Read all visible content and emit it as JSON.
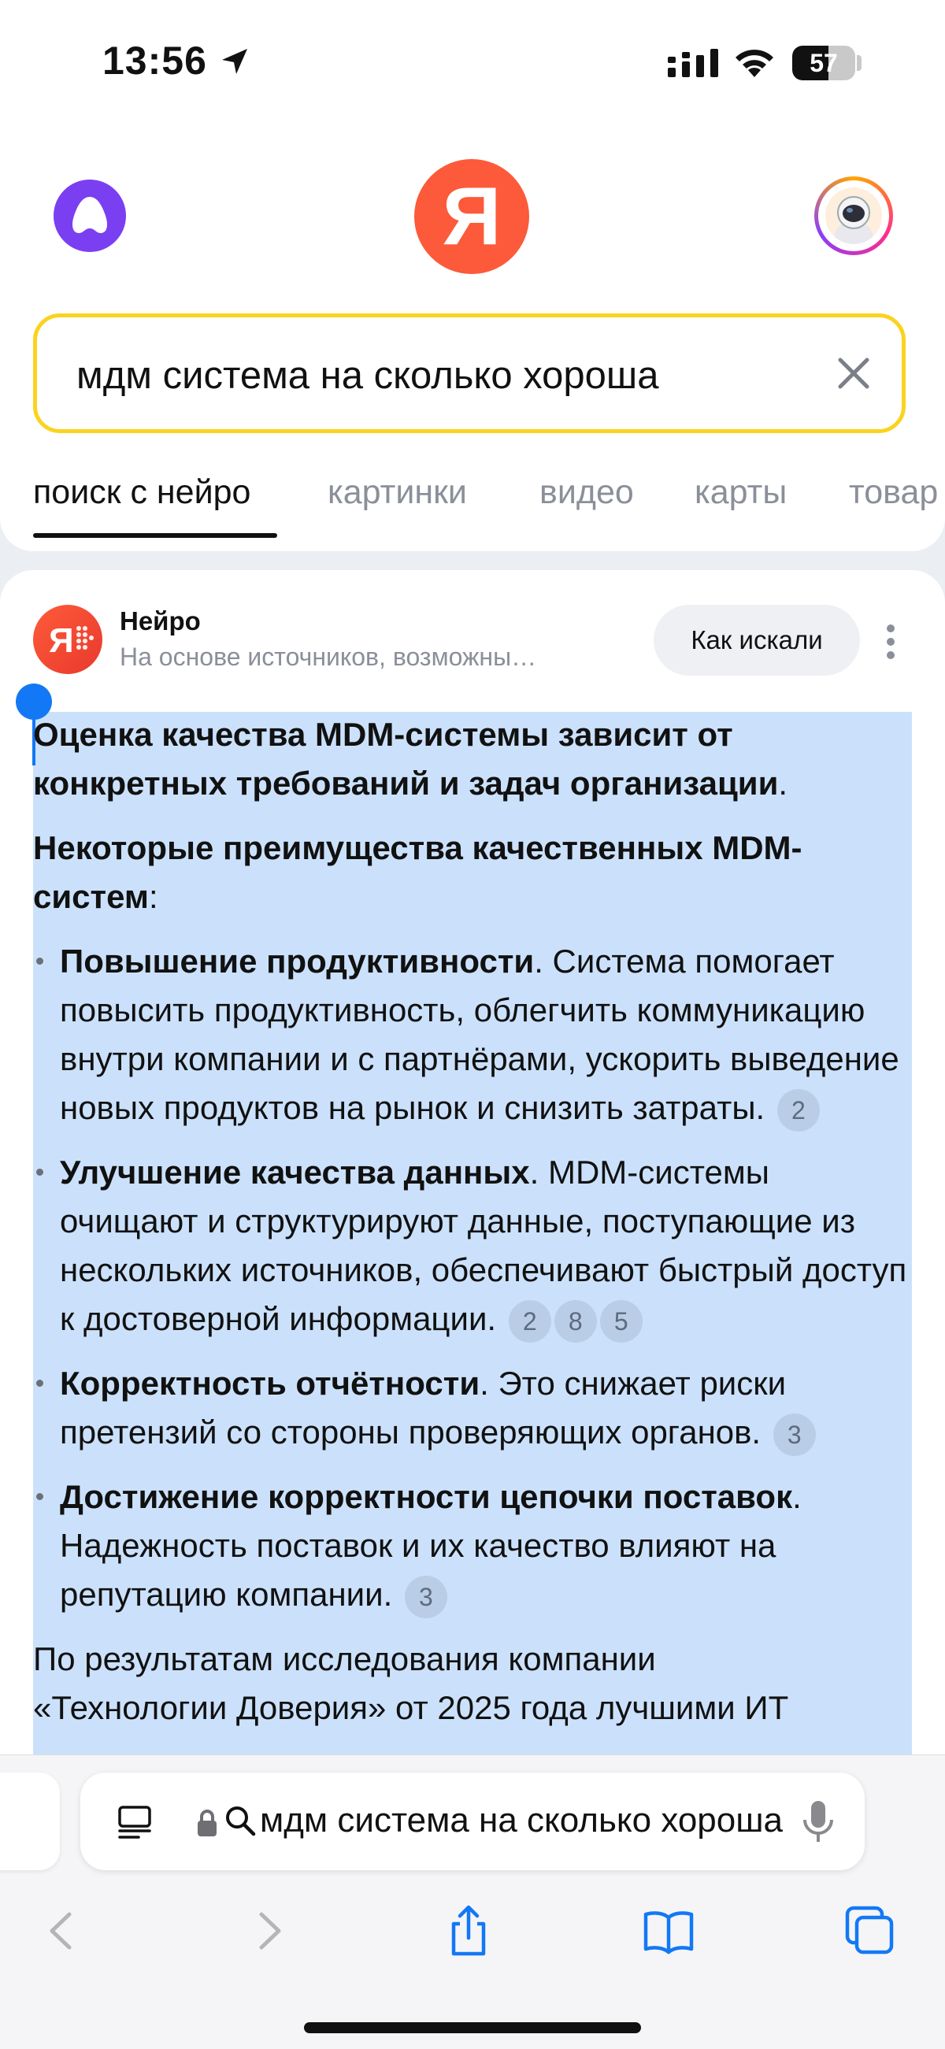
{
  "status_bar": {
    "time": "13:56",
    "battery": "57",
    "battery_level": 0.57
  },
  "header": {
    "logo_letter": "Я"
  },
  "search": {
    "query": "мдм система на сколько хороша"
  },
  "tabs": [
    {
      "label": "поиск с нейро",
      "active": true
    },
    {
      "label": "картинки",
      "active": false
    },
    {
      "label": "видео",
      "active": false
    },
    {
      "label": "карты",
      "active": false
    },
    {
      "label": "товар",
      "active": false
    }
  ],
  "neuro": {
    "title": "Нейро",
    "subtitle": "На основе источников, возможны…",
    "how_button": "Как искали",
    "intro_bold": "Оценка качества MDM-системы зависит от конкретных требований и задач организации",
    "intro_end": ".",
    "list_heading": "Некоторые преимущества качественных MDM-систем",
    "list_heading_end": ":",
    "items": [
      {
        "bold": "Повышение продуктивности",
        "text": ". Система помогает повысить продуктивность, облегчить коммуникацию внутри компании и с партнёрами, ускорить выведение новых продуктов на рынок и снизить затраты.",
        "citations": [
          "2"
        ]
      },
      {
        "bold": "Улучшение качества данных",
        "text": ". MDM-системы очищают и структурируют данные, поступающие из нескольких источников, обеспечивают быстрый доступ к достоверной информации.",
        "citations": [
          "2",
          "8",
          "5"
        ]
      },
      {
        "bold": "Корректность отчётности",
        "text": ". Это снижает риски претензий со стороны проверяющих органов.",
        "citations": [
          "3"
        ]
      },
      {
        "bold": "Достижение корректности цепочки поставок",
        "text": ". Надежность поставок и их качество влияют на репутацию компании.",
        "citations": [
          "3"
        ]
      }
    ],
    "closing_line": "По результатам исследования компании",
    "closing_cut": "«Технологии Доверия» от 2025 года лучшими ИТ"
  },
  "browser": {
    "url_text": "мдм система на сколько хороша"
  },
  "colors": {
    "accent_yellow": "#fbd31f",
    "yandex_red": "#fc5a3a",
    "alice_purple": "#7b3ff2",
    "selection": "#cbe1fb",
    "ios_blue": "#1378f5"
  }
}
